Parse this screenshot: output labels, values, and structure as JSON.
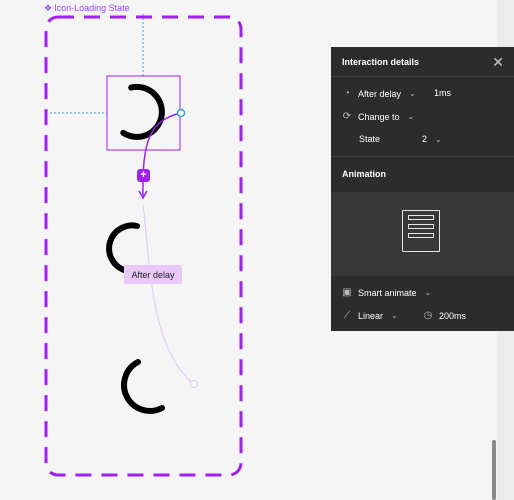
{
  "canvas": {
    "component_label": "Icon-Loading State",
    "component_icon": "component-icon",
    "delay_tag": "After delay",
    "add_badge": "+"
  },
  "panel": {
    "title": "Interaction details",
    "close_icon": "close-icon",
    "trigger": {
      "label": "After delay",
      "value": "1ms",
      "icon": "clock-icon"
    },
    "action": {
      "label": "Change to",
      "icon": "swap-icon"
    },
    "state": {
      "label": "State",
      "value": "2"
    },
    "animation_title": "Animation",
    "animation_type": {
      "label": "Smart animate",
      "icon": "smart-animate-icon"
    },
    "easing": {
      "label": "Linear",
      "icon": "easing-curve-icon"
    },
    "duration": {
      "value": "200ms",
      "icon": "timer-icon"
    }
  },
  "colors": {
    "accent": "#9747ff",
    "prototype": "#a020f0",
    "panel_bg": "#2c2c2c",
    "canvas_bg": "#f5f5f5"
  }
}
